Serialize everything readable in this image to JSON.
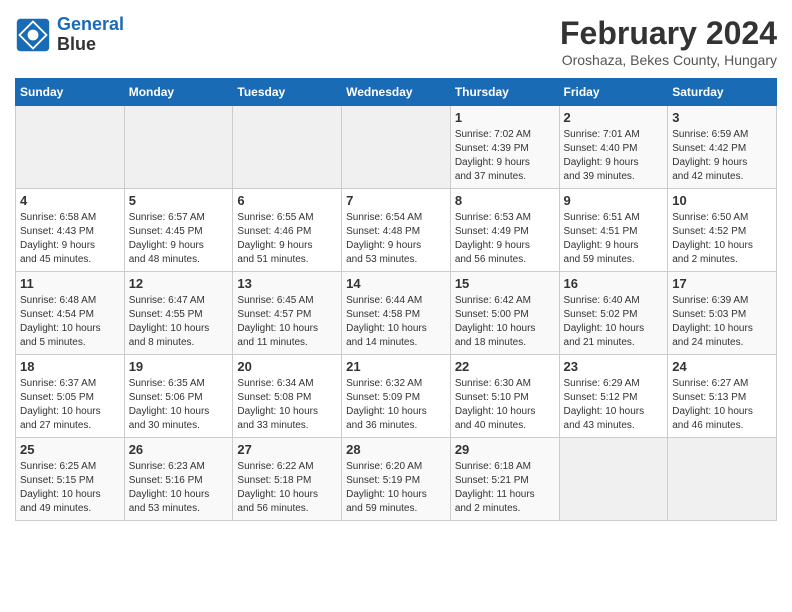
{
  "header": {
    "logo_line1": "General",
    "logo_line2": "Blue",
    "month": "February 2024",
    "location": "Oroshaza, Bekes County, Hungary"
  },
  "weekdays": [
    "Sunday",
    "Monday",
    "Tuesday",
    "Wednesday",
    "Thursday",
    "Friday",
    "Saturday"
  ],
  "weeks": [
    [
      {
        "day": "",
        "info": ""
      },
      {
        "day": "",
        "info": ""
      },
      {
        "day": "",
        "info": ""
      },
      {
        "day": "",
        "info": ""
      },
      {
        "day": "1",
        "info": "Sunrise: 7:02 AM\nSunset: 4:39 PM\nDaylight: 9 hours\nand 37 minutes."
      },
      {
        "day": "2",
        "info": "Sunrise: 7:01 AM\nSunset: 4:40 PM\nDaylight: 9 hours\nand 39 minutes."
      },
      {
        "day": "3",
        "info": "Sunrise: 6:59 AM\nSunset: 4:42 PM\nDaylight: 9 hours\nand 42 minutes."
      }
    ],
    [
      {
        "day": "4",
        "info": "Sunrise: 6:58 AM\nSunset: 4:43 PM\nDaylight: 9 hours\nand 45 minutes."
      },
      {
        "day": "5",
        "info": "Sunrise: 6:57 AM\nSunset: 4:45 PM\nDaylight: 9 hours\nand 48 minutes."
      },
      {
        "day": "6",
        "info": "Sunrise: 6:55 AM\nSunset: 4:46 PM\nDaylight: 9 hours\nand 51 minutes."
      },
      {
        "day": "7",
        "info": "Sunrise: 6:54 AM\nSunset: 4:48 PM\nDaylight: 9 hours\nand 53 minutes."
      },
      {
        "day": "8",
        "info": "Sunrise: 6:53 AM\nSunset: 4:49 PM\nDaylight: 9 hours\nand 56 minutes."
      },
      {
        "day": "9",
        "info": "Sunrise: 6:51 AM\nSunset: 4:51 PM\nDaylight: 9 hours\nand 59 minutes."
      },
      {
        "day": "10",
        "info": "Sunrise: 6:50 AM\nSunset: 4:52 PM\nDaylight: 10 hours\nand 2 minutes."
      }
    ],
    [
      {
        "day": "11",
        "info": "Sunrise: 6:48 AM\nSunset: 4:54 PM\nDaylight: 10 hours\nand 5 minutes."
      },
      {
        "day": "12",
        "info": "Sunrise: 6:47 AM\nSunset: 4:55 PM\nDaylight: 10 hours\nand 8 minutes."
      },
      {
        "day": "13",
        "info": "Sunrise: 6:45 AM\nSunset: 4:57 PM\nDaylight: 10 hours\nand 11 minutes."
      },
      {
        "day": "14",
        "info": "Sunrise: 6:44 AM\nSunset: 4:58 PM\nDaylight: 10 hours\nand 14 minutes."
      },
      {
        "day": "15",
        "info": "Sunrise: 6:42 AM\nSunset: 5:00 PM\nDaylight: 10 hours\nand 18 minutes."
      },
      {
        "day": "16",
        "info": "Sunrise: 6:40 AM\nSunset: 5:02 PM\nDaylight: 10 hours\nand 21 minutes."
      },
      {
        "day": "17",
        "info": "Sunrise: 6:39 AM\nSunset: 5:03 PM\nDaylight: 10 hours\nand 24 minutes."
      }
    ],
    [
      {
        "day": "18",
        "info": "Sunrise: 6:37 AM\nSunset: 5:05 PM\nDaylight: 10 hours\nand 27 minutes."
      },
      {
        "day": "19",
        "info": "Sunrise: 6:35 AM\nSunset: 5:06 PM\nDaylight: 10 hours\nand 30 minutes."
      },
      {
        "day": "20",
        "info": "Sunrise: 6:34 AM\nSunset: 5:08 PM\nDaylight: 10 hours\nand 33 minutes."
      },
      {
        "day": "21",
        "info": "Sunrise: 6:32 AM\nSunset: 5:09 PM\nDaylight: 10 hours\nand 36 minutes."
      },
      {
        "day": "22",
        "info": "Sunrise: 6:30 AM\nSunset: 5:10 PM\nDaylight: 10 hours\nand 40 minutes."
      },
      {
        "day": "23",
        "info": "Sunrise: 6:29 AM\nSunset: 5:12 PM\nDaylight: 10 hours\nand 43 minutes."
      },
      {
        "day": "24",
        "info": "Sunrise: 6:27 AM\nSunset: 5:13 PM\nDaylight: 10 hours\nand 46 minutes."
      }
    ],
    [
      {
        "day": "25",
        "info": "Sunrise: 6:25 AM\nSunset: 5:15 PM\nDaylight: 10 hours\nand 49 minutes."
      },
      {
        "day": "26",
        "info": "Sunrise: 6:23 AM\nSunset: 5:16 PM\nDaylight: 10 hours\nand 53 minutes."
      },
      {
        "day": "27",
        "info": "Sunrise: 6:22 AM\nSunset: 5:18 PM\nDaylight: 10 hours\nand 56 minutes."
      },
      {
        "day": "28",
        "info": "Sunrise: 6:20 AM\nSunset: 5:19 PM\nDaylight: 10 hours\nand 59 minutes."
      },
      {
        "day": "29",
        "info": "Sunrise: 6:18 AM\nSunset: 5:21 PM\nDaylight: 11 hours\nand 2 minutes."
      },
      {
        "day": "",
        "info": ""
      },
      {
        "day": "",
        "info": ""
      }
    ]
  ]
}
